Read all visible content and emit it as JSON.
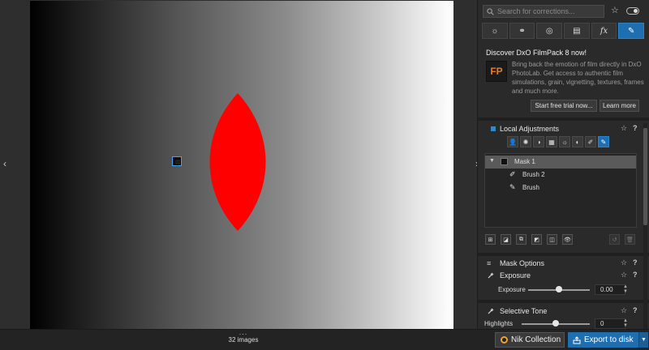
{
  "viewer": {
    "shape_color": "#ff0000",
    "left_arrow": "‹",
    "right_arrow": "›"
  },
  "bottombar": {
    "more": "...",
    "images_count": "32 images",
    "nik_label": "Nik Collection",
    "export_label": "Export to disk",
    "export_dropdown": "▼"
  },
  "panel": {
    "search_placeholder": "Search for corrections...",
    "favorite_icon": "☆",
    "palettes": [
      {
        "icon": "sun-icon",
        "glyph": "☼"
      },
      {
        "icon": "color-circles-icon",
        "glyph": "⚭"
      },
      {
        "icon": "detail-icon",
        "glyph": "◎"
      },
      {
        "icon": "geometry-icon",
        "glyph": "▤"
      },
      {
        "icon": "fx-icon",
        "glyph": "fx"
      },
      {
        "icon": "local-adjust-icon",
        "glyph": "✎"
      }
    ],
    "promo": {
      "title": "Discover DxO FilmPack 8 now!",
      "logo_text": "FP",
      "text": "Bring back the emotion of film directly in DxO PhotoLab. Get access to authentic film simulations, grain, vignetting, textures, frames and much more.",
      "trial_label": "Start free trial now...",
      "learn_label": "Learn more"
    },
    "local_adjustments": {
      "title": "Local Adjustments",
      "star": "☆",
      "help": "?",
      "tools": [
        "👤",
        "✺",
        "◑",
        "▦",
        "☼",
        "◐",
        "✐",
        "✎"
      ],
      "masks": [
        {
          "name": "Mask 1",
          "expand": "▼"
        },
        {
          "name": "Brush 2",
          "icon": "brush-eraser-icon",
          "glyph": "✐"
        },
        {
          "name": "Brush",
          "icon": "brush-icon",
          "glyph": "✎"
        }
      ],
      "mask_tools": [
        "⊞",
        "◪",
        "⧉",
        "◩",
        "◫",
        "👁"
      ],
      "mask_tools_right": [
        "↺",
        "🗑"
      ]
    },
    "mask_options": {
      "title": "Mask Options",
      "star": "☆",
      "help": "?",
      "icon": "≡"
    },
    "exposure": {
      "title": "Exposure",
      "star": "☆",
      "help": "?",
      "slider_label": "Exposure",
      "value": "0.00",
      "level": 0.5
    },
    "selective_tone": {
      "title": "Selective Tone",
      "star": "☆",
      "help": "?",
      "slider_label": "Highlights",
      "value": "0",
      "level": 0.5
    }
  }
}
